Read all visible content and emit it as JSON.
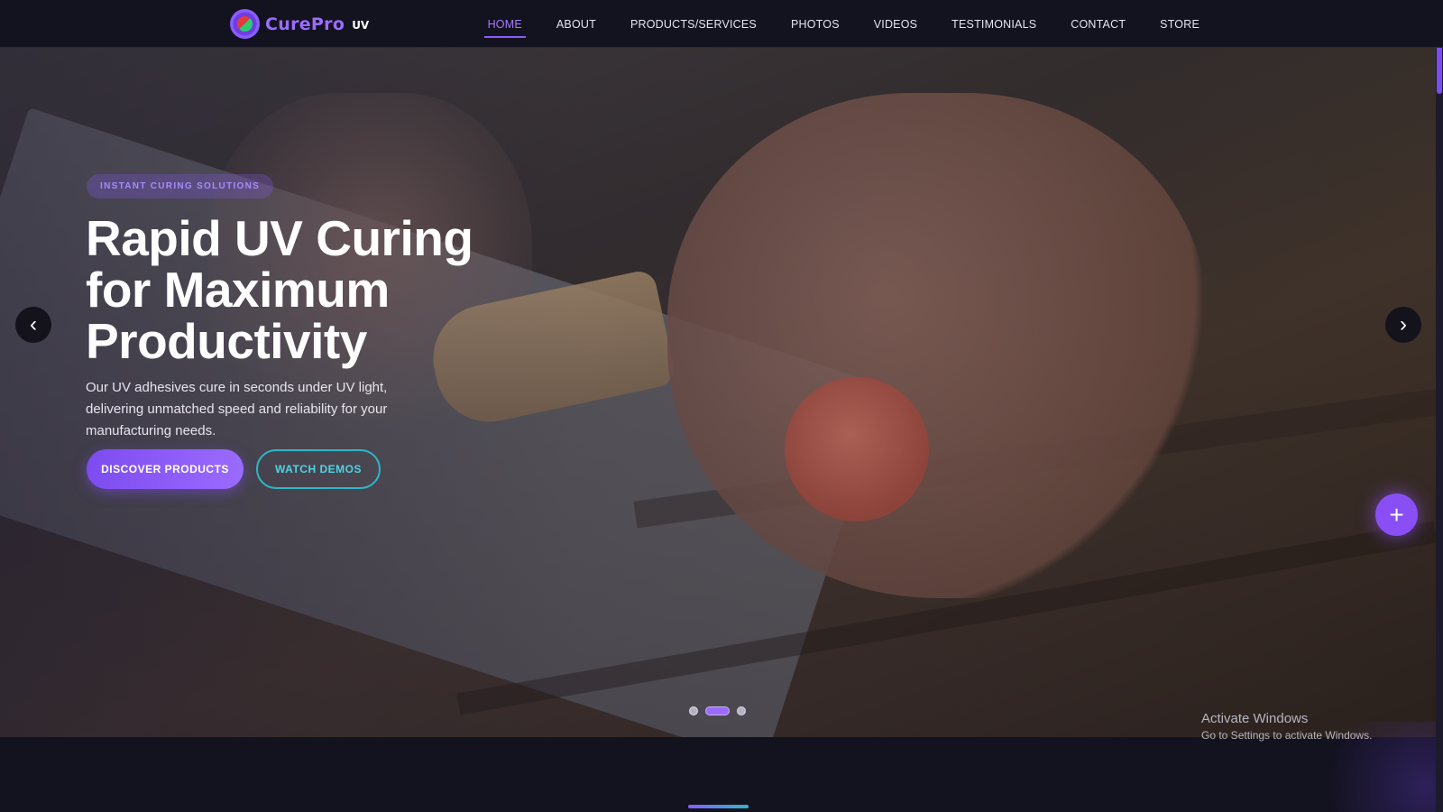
{
  "brand": {
    "name": "CurePro",
    "suffix": "UV"
  },
  "nav": {
    "items": [
      {
        "label": "HOME",
        "active": true
      },
      {
        "label": "ABOUT"
      },
      {
        "label": "PRODUCTS/SERVICES"
      },
      {
        "label": "PHOTOS"
      },
      {
        "label": "VIDEOS"
      },
      {
        "label": "TESTIMONIALS"
      },
      {
        "label": "CONTACT"
      },
      {
        "label": "STORE"
      }
    ]
  },
  "hero": {
    "eyebrow": "INSTANT CURING SOLUTIONS",
    "headline": "Rapid UV Curing for Maximum Productivity",
    "subtext": "Our UV adhesives cure in seconds under UV light, delivering unmatched speed and reliability for your manufacturing needs.",
    "primary_button": "DISCOVER PRODUCTS",
    "secondary_button": "WATCH DEMOS",
    "prev_arrow": "‹",
    "next_arrow": "›",
    "slides": {
      "count": 3,
      "active_index": 1
    }
  },
  "fab": {
    "icon": "+"
  },
  "watermark": {
    "title": "Activate Windows",
    "subtitle": "Go to Settings to activate Windows."
  },
  "colors": {
    "accent": "#8a5cff",
    "cyan": "#2bb8c9",
    "background": "#13121f"
  }
}
